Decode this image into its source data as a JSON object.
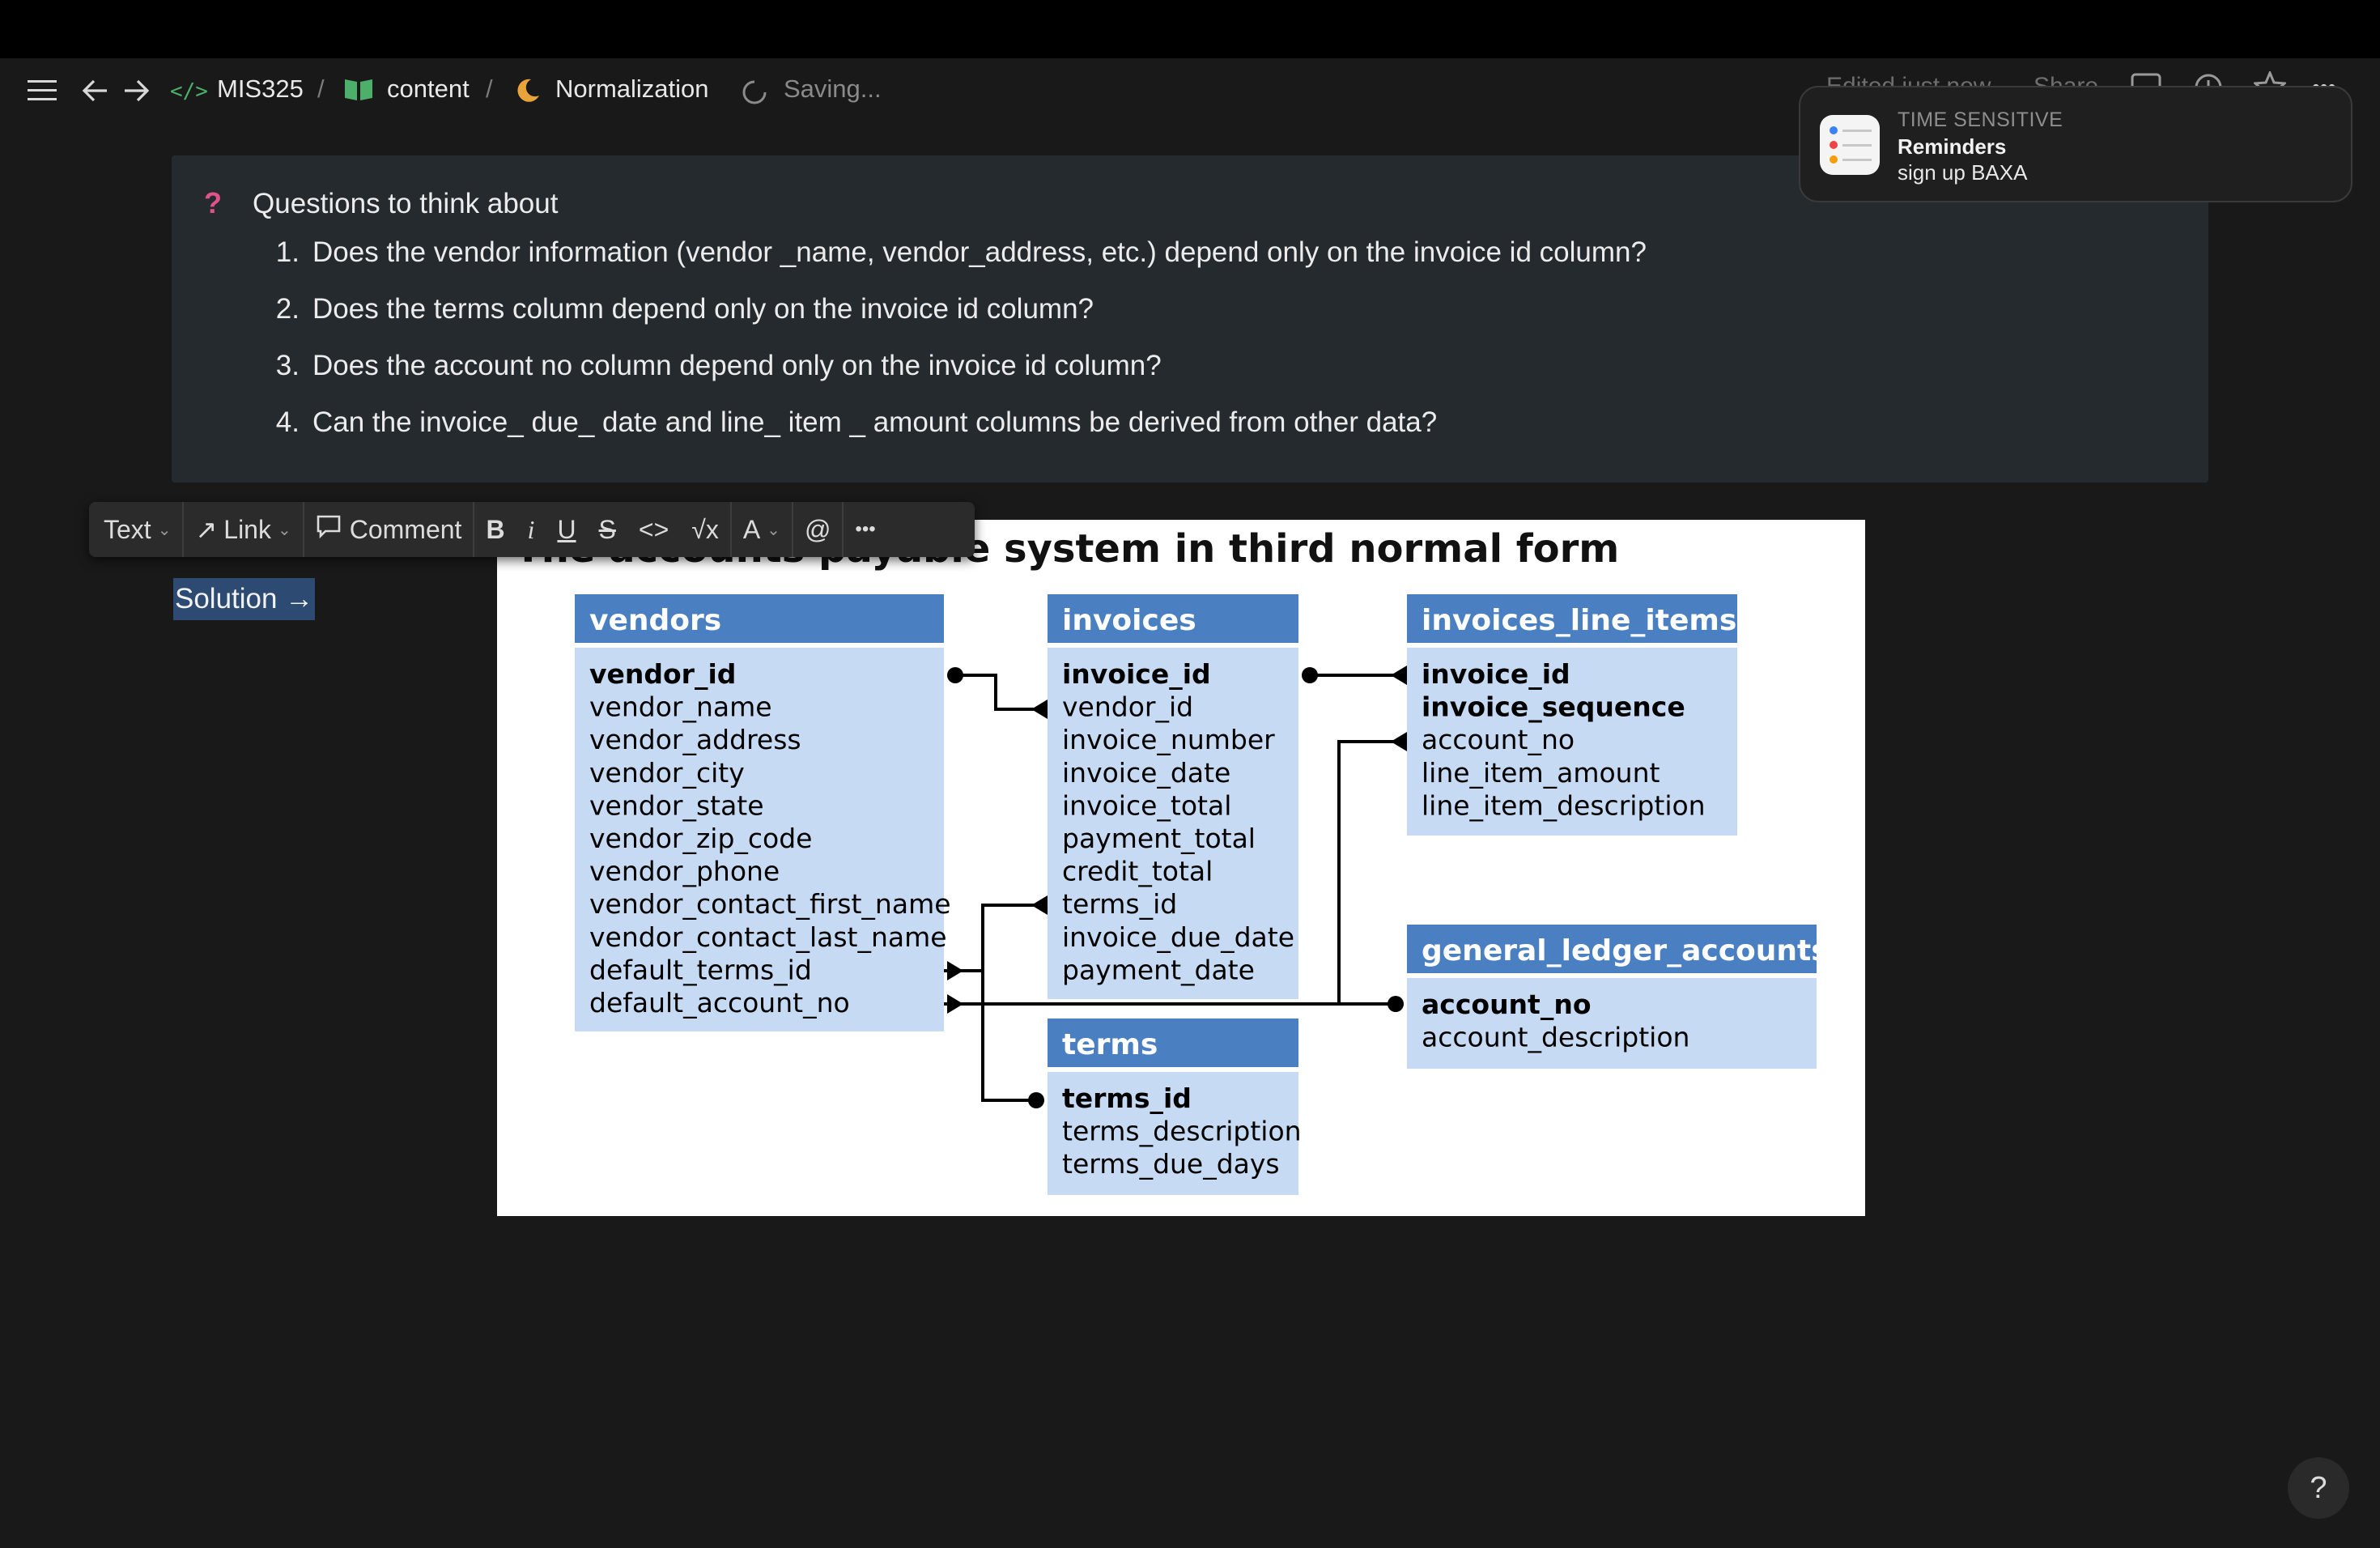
{
  "nav": {
    "breadcrumbs": [
      {
        "label": "MIS325",
        "icon": "code-icon"
      },
      {
        "label": "content",
        "icon": "book-icon"
      },
      {
        "label": "Normalization",
        "icon": "moon-icon"
      }
    ],
    "separator": "/",
    "status": "Saving...",
    "faded_right": [
      "Edited just now",
      "Share"
    ]
  },
  "callout": {
    "icon": "?",
    "title": "Questions to think about",
    "questions": [
      {
        "num": "1.",
        "text": "Does the vendor information (vendor _name, vendor_address, etc.) depend only on the invoice id column?"
      },
      {
        "num": "2.",
        "text": "Does the terms column depend only on the invoice id column?"
      },
      {
        "num": "3.",
        "text": "Does the account no column depend only on the invoice id column?"
      },
      {
        "num": "4.",
        "text": "Can the invoice_ due_ date and line_ item _ amount columns be derived from other data?"
      }
    ]
  },
  "notification": {
    "tag": "TIME SENSITIVE",
    "title": "Reminders",
    "body": "sign up BAXA"
  },
  "toolbar": {
    "text_label": "Text",
    "link_label": "Link",
    "comment_label": "Comment",
    "bold": "B",
    "italic": "i",
    "underline": "U",
    "strike": "S",
    "code": "<>",
    "math": "√x",
    "color": "A",
    "mention": "@",
    "more": "•••"
  },
  "solution_link": "Solution →",
  "diagram": {
    "title": "The accounts payable system in third normal form",
    "tables": {
      "vendors": {
        "name": "vendors",
        "keys": [
          "vendor_id"
        ],
        "columns": [
          "vendor_name",
          "vendor_address",
          "vendor_city",
          "vendor_state",
          "vendor_zip_code",
          "vendor_phone",
          "vendor_contact_first_name",
          "vendor_contact_last_name",
          "default_terms_id",
          "default_account_no"
        ]
      },
      "invoices": {
        "name": "invoices",
        "keys": [
          "invoice_id"
        ],
        "columns": [
          "vendor_id",
          "invoice_number",
          "invoice_date",
          "invoice_total",
          "payment_total",
          "credit_total",
          "terms_id",
          "invoice_due_date",
          "payment_date"
        ]
      },
      "invoices_line_items": {
        "name": "invoices_line_items",
        "keys": [
          "invoice_id",
          "invoice_sequence"
        ],
        "columns": [
          "account_no",
          "line_item_amount",
          "line_item_description"
        ]
      },
      "general_ledger_accounts": {
        "name": "general_ledger_accounts",
        "keys": [
          "account_no"
        ],
        "columns": [
          "account_description"
        ]
      },
      "terms": {
        "name": "terms",
        "keys": [
          "terms_id"
        ],
        "columns": [
          "terms_description",
          "terms_due_days"
        ]
      }
    },
    "colors": {
      "header": "#4a7fc1",
      "body": "#c6dbf3",
      "line": "#000000"
    }
  },
  "help_label": "?"
}
